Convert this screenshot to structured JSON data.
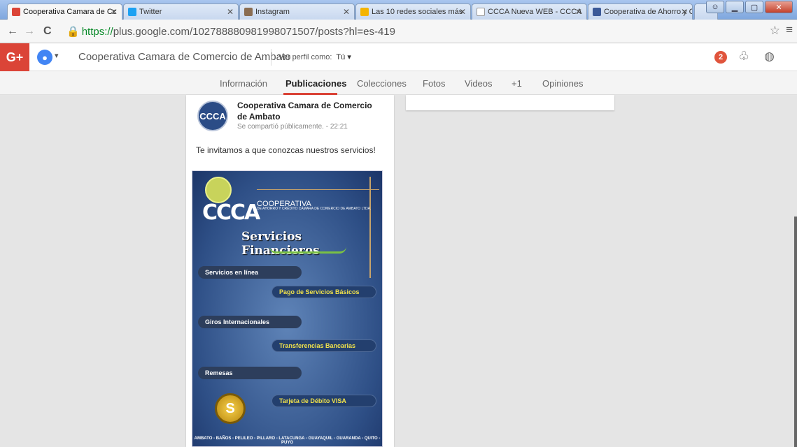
{
  "browser": {
    "tabs": [
      {
        "title": "Cooperativa Camara de Cc",
        "favicon": "google-plus-icon",
        "color": "#db4437"
      },
      {
        "title": "Twitter",
        "favicon": "twitter-icon",
        "color": "#1da1f2"
      },
      {
        "title": "Instagram",
        "favicon": "instagram-icon",
        "color": "#8a6d52"
      },
      {
        "title": "Las 10 redes sociales más",
        "favicon": "bing-icon",
        "color": "#f4b400"
      },
      {
        "title": "CCCA Nueva WEB - CCCA",
        "favicon": "page-icon",
        "color": "#ffffff"
      },
      {
        "title": "Cooperativa de Ahorro y C",
        "favicon": "facebook-icon",
        "color": "#3b5998"
      }
    ],
    "url_scheme": "https://",
    "url_rest": "plus.google.com/102788880981998071507/posts?hl=es-419"
  },
  "gbar": {
    "logo": "G+",
    "page_name": "Cooperativa Camara de Comercio de Ambato",
    "view_as_label": "Ver perfil como:",
    "view_as_value": "Tú ▾",
    "notifications": "2"
  },
  "profile_tabs": [
    "Información",
    "Publicaciones",
    "Colecciones",
    "Fotos",
    "Videos",
    "+1",
    "Opiniones"
  ],
  "post": {
    "avatar_text": "CCCA",
    "author": "Cooperativa Camara de Comercio de Ambato",
    "meta": "Se compartió públicamente.  -  22:21",
    "text": "Te invitamos a que conozcas nuestros servicios!",
    "flyer": {
      "logo": "CCCA",
      "coop_title": "COOPERATIVA",
      "coop_sub": "DE AHORRO Y CRÉDITO CÁMARA DE COMERCIO DE AMBATO LTDA.",
      "title": "Servicios Financieros",
      "items": [
        {
          "label": "Servicios en línea",
          "style": "gray"
        },
        {
          "label": "Pago de Servicios Básicos",
          "style": "yellow"
        },
        {
          "label": "Giros Internacionales",
          "style": "gray"
        },
        {
          "label": "Transferencias Bancarias",
          "style": "yellow"
        },
        {
          "label": "Remesas",
          "style": "gray"
        },
        {
          "label": "Tarjeta de Débito VISA",
          "style": "yellow"
        }
      ],
      "coin": "S",
      "footer": "AMBATO - BAÑOS - PELILEO - PILLARO - LATACUNGA - GUAYAQUIL - GUARANDA - QUITO - PUYO"
    }
  }
}
